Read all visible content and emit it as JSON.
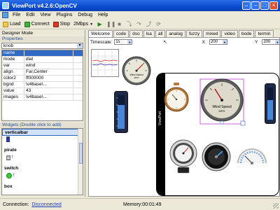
{
  "window": {
    "title": "ViewPort v4.2.6:OpenCV"
  },
  "menu": [
    "File",
    "Edit",
    "View",
    "Plugins",
    "Debug",
    "Help"
  ],
  "toolbar": {
    "load": "Load",
    "connect": "Connect",
    "stop": "Stop",
    "speed": "2Mbps"
  },
  "left_panel": {
    "title": "Designer Mode",
    "properties_header": "Properties",
    "selected_component": "knob",
    "props": [
      {
        "key": "name",
        "value": "",
        "selected": true
      },
      {
        "key": "mode",
        "value": "dial"
      },
      {
        "key": "var",
        "value": "wind"
      },
      {
        "key": "align",
        "value": "Far,Center"
      },
      {
        "key": "color2",
        "value": "ff000000"
      },
      {
        "key": "bgnd",
        "value": "\\v4base\\..."
      },
      {
        "key": "value",
        "value": "43"
      },
      {
        "key": "images",
        "value": "\\v4base\\..."
      }
    ],
    "widgets_header": "Widgets (Double click to add)",
    "widgets": [
      {
        "name": "verticalbar",
        "icon": "vertical-bar-icon"
      },
      {
        "name": "pirate",
        "icon": "bars-icon"
      },
      {
        "name": "switch",
        "icon": "green-led-icon"
      },
      {
        "name": "box",
        "icon": ""
      }
    ]
  },
  "tabs": [
    "Welcome",
    "code",
    "dso",
    "lsa",
    "all",
    "analog",
    "fuzzy",
    "mixed",
    "video",
    "bode",
    "termin"
  ],
  "timescale": {
    "label": "Timescale:",
    "value": "1s",
    "x_label": "X",
    "x_value": "200",
    "y_label": "Y",
    "y_value": "200"
  },
  "gauge_labels": {
    "wind": "Wind Speed",
    "mph": "MPH",
    "brand": "ViewPort"
  },
  "gauge_values": {
    "selected_knob": 43
  },
  "status": {
    "connection_label": "Connection:",
    "connection_value": "Disconnected",
    "memory": "Memory:00:01:49"
  }
}
